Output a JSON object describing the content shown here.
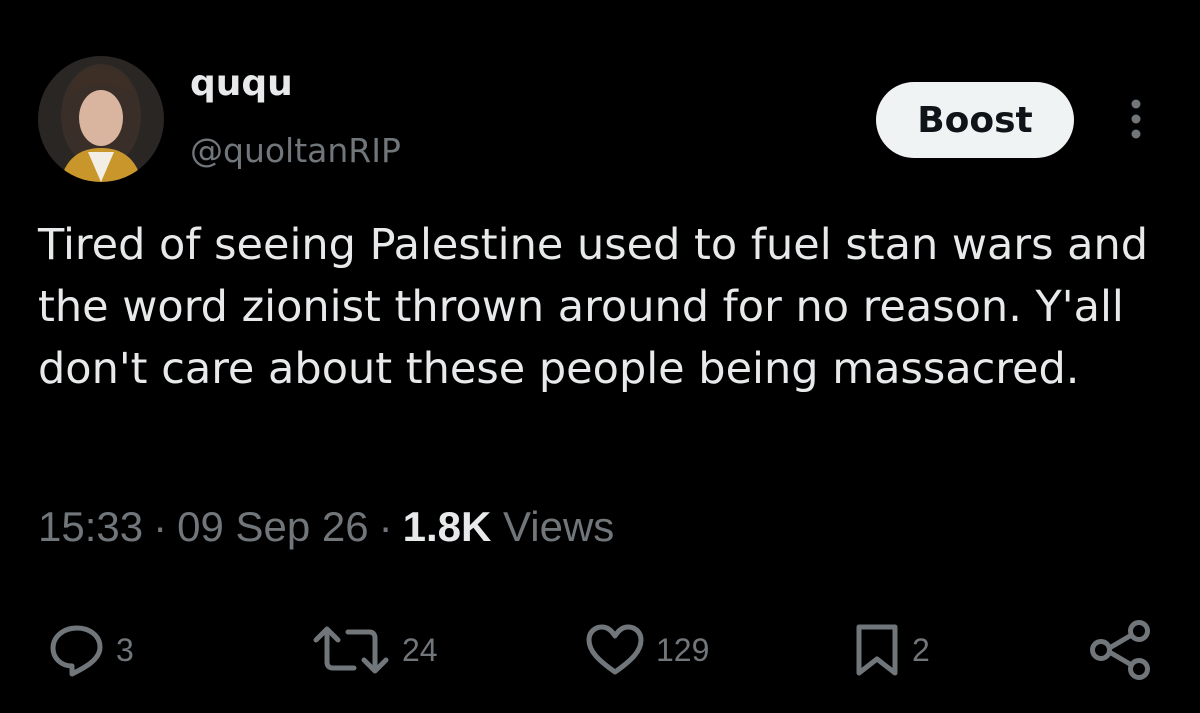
{
  "author": {
    "display_name": "ququ",
    "handle": "@quoltanRIP"
  },
  "header": {
    "boost_label": "Boost"
  },
  "tweet": {
    "text": "Tired of seeing Palestine used to fuel stan wars and the word zionist thrown around for no reason. Y'all don't care about these people being massacred."
  },
  "meta": {
    "time": "15:33",
    "separator": "·",
    "date": "09 Sep 26",
    "views_count": "1.8K",
    "views_label": "Views"
  },
  "actions": {
    "reply_count": "3",
    "repost_count": "24",
    "like_count": "129",
    "bookmark_count": "2"
  },
  "icons": {
    "reply": "reply-icon",
    "repost": "repost-icon",
    "like": "heart-icon",
    "bookmark": "bookmark-icon",
    "share": "share-icon",
    "more": "more-options-icon"
  },
  "colors": {
    "background": "#000000",
    "primary_text": "#e7e9ea",
    "secondary_text": "#71767b",
    "button_bg": "#eff3f4",
    "button_text": "#0f1419"
  }
}
